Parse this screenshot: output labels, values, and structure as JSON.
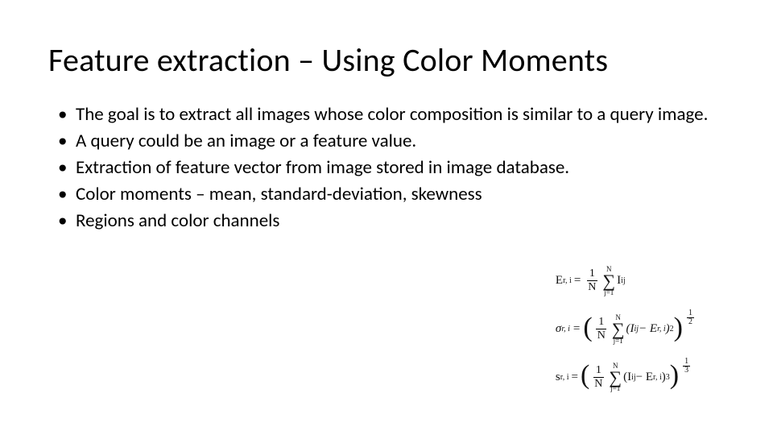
{
  "title": "Feature extraction – Using Color Moments",
  "bullets": [
    "The goal is to extract all images whose color composition is similar to a query image.",
    "A query could be an image or a feature value.",
    "Extraction of feature vector from image stored in image database.",
    "Color moments – mean, standard-deviation, skewness",
    "Regions and color channels"
  ],
  "formulas": {
    "mean": {
      "lhs": "E",
      "lhs_sub": "r, i",
      "eq": "=",
      "frac_num": "1",
      "frac_den": "N",
      "sum_top": "N",
      "sum_bot": "j=1",
      "term": "I",
      "term_sub": "ij"
    },
    "std": {
      "lhs": "σ",
      "lhs_sub": "r, i",
      "eq": "=",
      "frac_num": "1",
      "frac_den": "N",
      "sum_top": "N",
      "sum_bot": "j=1",
      "inner_l": "(I",
      "inner_lsub": "ij",
      "inner_mid": " − E",
      "inner_rsub": "r, i",
      "inner_close": ")",
      "inner_exp": "2",
      "outer_num": "1",
      "outer_den": "2"
    },
    "skew": {
      "lhs": "s",
      "lhs_sub": "r, i",
      "eq": "=",
      "frac_num": "1",
      "frac_den": "N",
      "sum_top": "N",
      "sum_bot": "j=1",
      "inner_l": "(I",
      "inner_lsub": "ij",
      "inner_mid": " − E",
      "inner_rsub": "r, i",
      "inner_close": ")",
      "inner_exp": "3",
      "outer_num": "1",
      "outer_den": "3"
    }
  }
}
